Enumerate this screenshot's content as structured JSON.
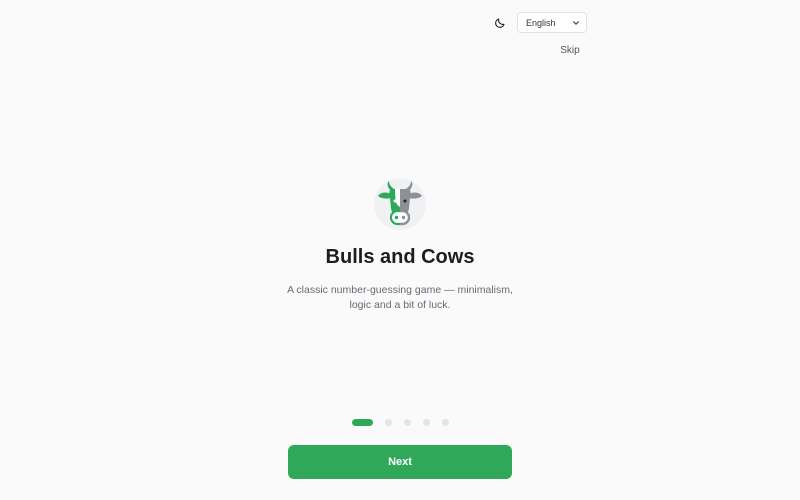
{
  "header": {
    "theme_icon": "moon-icon",
    "language": {
      "selected": "English",
      "icon": "chevron-down-icon"
    }
  },
  "skip_label": "Skip",
  "slide": {
    "logo_icon": "bull-cow-icon",
    "title": "Bulls and Cows",
    "subtitle": "A classic number-guessing game — minimalism, logic and a bit of luck."
  },
  "pagination": {
    "total": 5,
    "current": 1
  },
  "next_label": "Next",
  "colors": {
    "accent": "#2fa85a",
    "cow_gray": "#8e9097",
    "background": "#fafafa",
    "dot_inactive": "#e3e4e6"
  }
}
